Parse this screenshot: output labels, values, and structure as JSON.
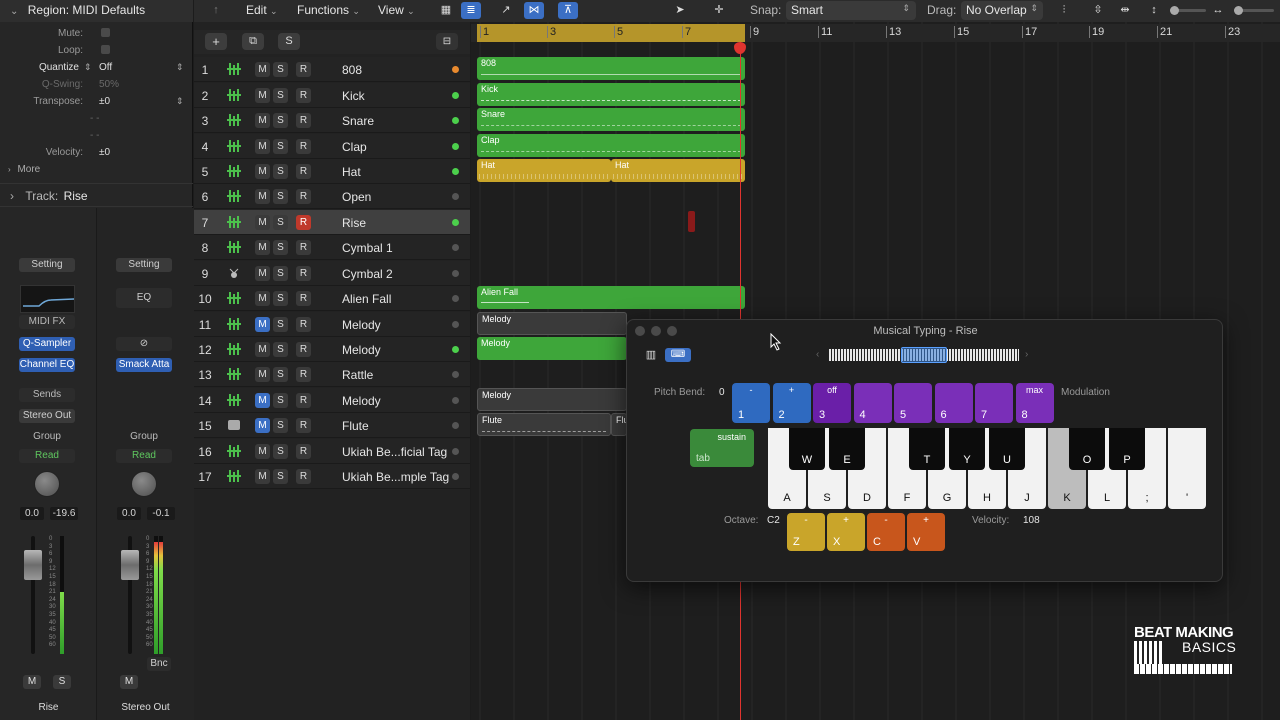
{
  "inspector": {
    "region_title": "Region: MIDI Defaults",
    "params": [
      {
        "label": "Mute:",
        "value": ""
      },
      {
        "label": "Loop:",
        "value": ""
      },
      {
        "label": "Quantize",
        "value": "Off"
      },
      {
        "label": "Q-Swing:",
        "value": "50%"
      },
      {
        "label": "Transpose:",
        "value": "±0"
      },
      {
        "label": "",
        "value": "- -"
      },
      {
        "label": "",
        "value": "- -"
      },
      {
        "label": "Velocity:",
        "value": "±0"
      }
    ],
    "more": "More",
    "track_label": "Track:",
    "track_name": "Rise",
    "strip1": {
      "setting": "Setting",
      "midi_fx": "MIDI FX",
      "instrument": "Q-Sampler",
      "eq_plugin": "Channel EQ",
      "sends": "Sends",
      "output": "Stereo Out",
      "group": "Group",
      "automation": "Read",
      "pan": "0.0",
      "level": "-19.6",
      "mute": "M",
      "solo": "S",
      "name": "Rise"
    },
    "strip2": {
      "setting": "Setting",
      "eq": "EQ",
      "link": "⊘",
      "instrument": "Smack Atta",
      "group": "Group",
      "automation": "Read",
      "pan": "0.0",
      "level": "-0.1",
      "bounce": "Bnc",
      "mute": "M",
      "name": "Stereo Out"
    }
  },
  "toolbar": {
    "edit": "Edit",
    "functions": "Functions",
    "view": "View",
    "snap_label": "Snap:",
    "snap_value": "Smart",
    "drag_label": "Drag:",
    "drag_value": "No Overlap"
  },
  "track_header": {
    "add": "+",
    "dup": "⧉",
    "solo": "S",
    "collapse": "⊟"
  },
  "ruler": [
    "1",
    "3",
    "5",
    "7",
    "9",
    "11",
    "13",
    "15",
    "17",
    "19",
    "21",
    "23"
  ],
  "tracks": [
    {
      "num": "1",
      "name": "808",
      "m": "M",
      "s": "S",
      "r": "R"
    },
    {
      "num": "2",
      "name": "Kick",
      "m": "M",
      "s": "S",
      "r": "R"
    },
    {
      "num": "3",
      "name": "Snare",
      "m": "M",
      "s": "S",
      "r": "R"
    },
    {
      "num": "4",
      "name": "Clap",
      "m": "M",
      "s": "S",
      "r": "R"
    },
    {
      "num": "5",
      "name": "Hat",
      "m": "M",
      "s": "S",
      "r": "R"
    },
    {
      "num": "6",
      "name": "Open",
      "m": "M",
      "s": "S",
      "r": "R"
    },
    {
      "num": "7",
      "name": "Rise",
      "m": "M",
      "s": "S",
      "r": "R"
    },
    {
      "num": "8",
      "name": "Cymbal 1",
      "m": "M",
      "s": "S",
      "r": "R"
    },
    {
      "num": "9",
      "name": "Cymbal 2",
      "m": "M",
      "s": "S",
      "r": "R"
    },
    {
      "num": "10",
      "name": "Alien Fall",
      "m": "M",
      "s": "S",
      "r": "R"
    },
    {
      "num": "11",
      "name": "Melody",
      "m": "M",
      "s": "S",
      "r": "R"
    },
    {
      "num": "12",
      "name": "Melody",
      "m": "M",
      "s": "S",
      "r": "R"
    },
    {
      "num": "13",
      "name": "Rattle",
      "m": "M",
      "s": "S",
      "r": "R"
    },
    {
      "num": "14",
      "name": "Melody",
      "m": "M",
      "s": "S",
      "r": "R"
    },
    {
      "num": "15",
      "name": "Flute",
      "m": "M",
      "s": "S",
      "r": "R"
    },
    {
      "num": "16",
      "name": "Ukiah Be...ficial Tag",
      "m": "M",
      "s": "S",
      "r": "R"
    },
    {
      "num": "17",
      "name": "Ukiah Be...mple Tag",
      "m": "M",
      "s": "S",
      "r": "R"
    }
  ],
  "regions": {
    "r808": "808",
    "kick": "Kick",
    "snare": "Snare",
    "clap": "Clap",
    "hat1": "Hat",
    "hat2": "Hat",
    "alien": "Alien Fall",
    "mel11": "Melody",
    "mel12": "Melody",
    "mel14": "Melody",
    "flute1": "Flute",
    "flute2": "Flu"
  },
  "musical_typing": {
    "title": "Musical Typing - Rise",
    "pitch_bend_label": "Pitch Bend:",
    "pitch_bend_value": "0",
    "modulation_label": "Modulation",
    "mod_keys": [
      {
        "up": "-",
        "key": "1"
      },
      {
        "up": "+",
        "key": "2"
      },
      {
        "up": "off",
        "key": "3"
      },
      {
        "up": "",
        "key": "4"
      },
      {
        "up": "",
        "key": "5"
      },
      {
        "up": "",
        "key": "6"
      },
      {
        "up": "",
        "key": "7"
      },
      {
        "up": "max",
        "key": "8"
      }
    ],
    "sustain_label": "sustain",
    "sustain_key": "tab",
    "white_keys": [
      "A",
      "S",
      "D",
      "F",
      "G",
      "H",
      "J",
      "K",
      "L",
      ";",
      "'"
    ],
    "black_keys": [
      "W",
      "E",
      "T",
      "Y",
      "U",
      "O",
      "P"
    ],
    "octave_label": "Octave:",
    "octave_value": "C2",
    "octave_keys": [
      {
        "up": "-",
        "key": "Z"
      },
      {
        "up": "+",
        "key": "X"
      },
      {
        "up": "-",
        "key": "C"
      },
      {
        "up": "+",
        "key": "V"
      }
    ],
    "velocity_label": "Velocity:",
    "velocity_value": "108"
  },
  "watermark": {
    "line1": "BEAT MAKING",
    "line2": "BASICS"
  }
}
